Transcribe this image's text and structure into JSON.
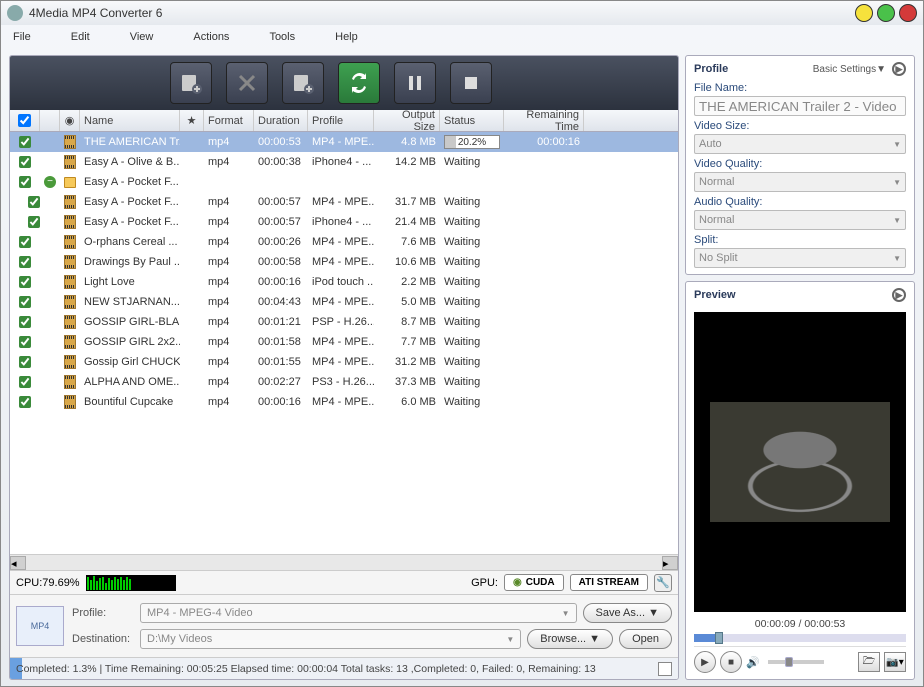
{
  "title": "4Media MP4 Converter 6",
  "menu": [
    "File",
    "Edit",
    "View",
    "Actions",
    "Tools",
    "Help"
  ],
  "columns": {
    "name": "Name",
    "format": "Format",
    "duration": "Duration",
    "profile": "Profile",
    "output": "Output Size",
    "status": "Status",
    "remain": "Remaining Time"
  },
  "rows": [
    {
      "indent": 0,
      "icon": "film",
      "name": "THE AMERICAN Tr...",
      "format": "mp4",
      "duration": "00:00:53",
      "profile": "MP4 - MPE...",
      "output": "4.8 MB",
      "status": "20.2%",
      "remain": "00:00:16",
      "selected": true,
      "progress": true
    },
    {
      "indent": 0,
      "icon": "film",
      "name": "Easy A - Olive & B...",
      "format": "mp4",
      "duration": "00:00:38",
      "profile": "iPhone4 - ...",
      "output": "14.2 MB",
      "status": "Waiting",
      "remain": ""
    },
    {
      "indent": 0,
      "icon": "folder",
      "pre": "minus",
      "name": "Easy A - Pocket F...",
      "format": "",
      "duration": "",
      "profile": "",
      "output": "",
      "status": "",
      "remain": ""
    },
    {
      "indent": 1,
      "icon": "film",
      "name": "Easy A - Pocket F...",
      "format": "mp4",
      "duration": "00:00:57",
      "profile": "MP4 - MPE...",
      "output": "31.7 MB",
      "status": "Waiting",
      "remain": ""
    },
    {
      "indent": 1,
      "icon": "film",
      "name": "Easy A - Pocket F...",
      "format": "mp4",
      "duration": "00:00:57",
      "profile": "iPhone4 - ...",
      "output": "21.4 MB",
      "status": "Waiting",
      "remain": ""
    },
    {
      "indent": 0,
      "icon": "film",
      "name": "O-rphans Cereal ...",
      "format": "mp4",
      "duration": "00:00:26",
      "profile": "MP4 - MPE...",
      "output": "7.6 MB",
      "status": "Waiting",
      "remain": ""
    },
    {
      "indent": 0,
      "icon": "film",
      "name": "Drawings By Paul ...",
      "format": "mp4",
      "duration": "00:00:58",
      "profile": "MP4 - MPE...",
      "output": "10.6 MB",
      "status": "Waiting",
      "remain": ""
    },
    {
      "indent": 0,
      "icon": "film",
      "name": "Light Love",
      "format": "mp4",
      "duration": "00:00:16",
      "profile": "iPod touch ...",
      "output": "2.2 MB",
      "status": "Waiting",
      "remain": ""
    },
    {
      "indent": 0,
      "icon": "film",
      "name": "NEW STJARNAN...",
      "format": "mp4",
      "duration": "00:04:43",
      "profile": "MP4 - MPE...",
      "output": "5.0 MB",
      "status": "Waiting",
      "remain": ""
    },
    {
      "indent": 0,
      "icon": "film",
      "name": "GOSSIP GIRL-BLA...",
      "format": "mp4",
      "duration": "00:01:21",
      "profile": "PSP - H.26...",
      "output": "8.7 MB",
      "status": "Waiting",
      "remain": ""
    },
    {
      "indent": 0,
      "icon": "film",
      "name": "GOSSIP GIRL 2x2...",
      "format": "mp4",
      "duration": "00:01:58",
      "profile": "MP4 - MPE...",
      "output": "7.7 MB",
      "status": "Waiting",
      "remain": ""
    },
    {
      "indent": 0,
      "icon": "film",
      "name": "Gossip Girl CHUCK...",
      "format": "mp4",
      "duration": "00:01:55",
      "profile": "MP4 - MPE...",
      "output": "31.2 MB",
      "status": "Waiting",
      "remain": ""
    },
    {
      "indent": 0,
      "icon": "film",
      "name": "ALPHA AND OME...",
      "format": "mp4",
      "duration": "00:02:27",
      "profile": "PS3 - H.26...",
      "output": "37.3 MB",
      "status": "Waiting",
      "remain": ""
    },
    {
      "indent": 0,
      "icon": "film",
      "name": "Bountiful Cupcake",
      "format": "mp4",
      "duration": "00:00:16",
      "profile": "MP4 - MPE...",
      "output": "6.0 MB",
      "status": "Waiting",
      "remain": ""
    }
  ],
  "cpu": {
    "label": "CPU:79.69%"
  },
  "gpu": {
    "label": "GPU:",
    "cuda": "CUDA",
    "ati": "ATI STREAM"
  },
  "bottom": {
    "profile_label": "Profile:",
    "profile_value": "MP4 - MPEG-4 Video",
    "saveas": "Save As...",
    "dest_label": "Destination:",
    "dest_value": "D:\\My Videos",
    "browse": "Browse...",
    "open": "Open"
  },
  "status": "Completed: 1.3% | Time Remaining: 00:05:25 Elapsed time: 00:00:04 Total tasks: 13 ,Completed: 0, Failed: 0, Remaining: 13",
  "right": {
    "profile_title": "Profile",
    "basic": "Basic Settings▼",
    "filename_label": "File Name:",
    "filename": "THE AMERICAN Trailer 2 - Video",
    "videosize_label": "Video Size:",
    "videosize": "Auto",
    "videoq_label": "Video Quality:",
    "videoq": "Normal",
    "audioq_label": "Audio Quality:",
    "audioq": "Normal",
    "split_label": "Split:",
    "split": "No Split",
    "preview_title": "Preview",
    "time": "00:00:09 / 00:00:53"
  }
}
